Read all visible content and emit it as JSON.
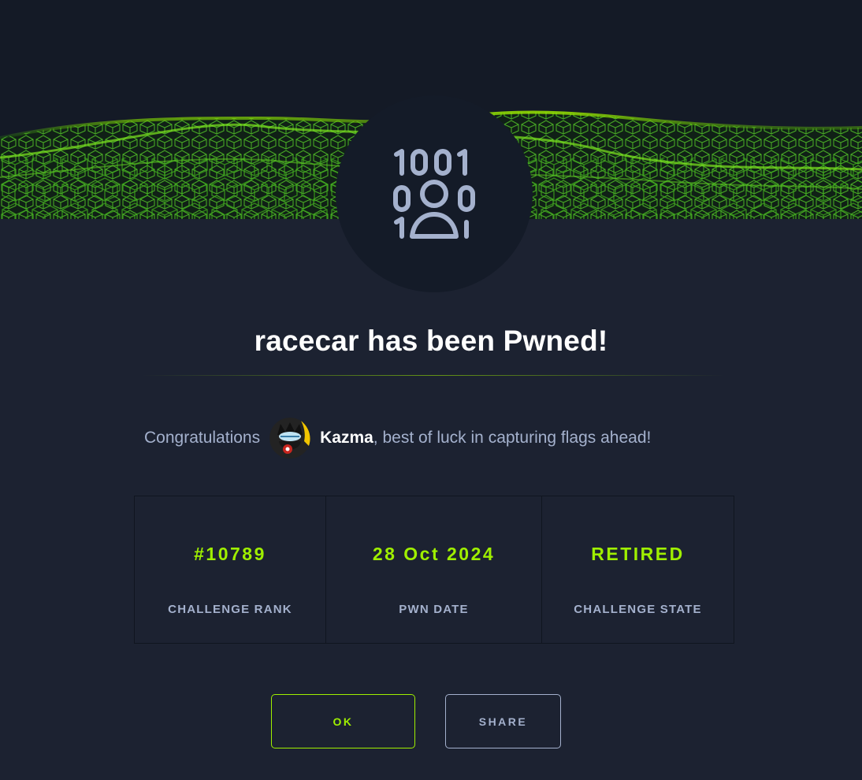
{
  "dialog": {
    "title": "racecar has been Pwned!",
    "congrats_prefix": "Congratulations",
    "username": "Kazma",
    "congrats_suffix": ", best of luck in capturing flags ahead!",
    "badge_icon": "binary-user-icon",
    "banner": "green-wave-cubes-pattern"
  },
  "stats": [
    {
      "value": "#10789",
      "label": "CHALLENGE RANK"
    },
    {
      "value": "28 Oct 2024",
      "label": "PWN DATE"
    },
    {
      "value": "RETIRED",
      "label": "CHALLENGE STATE"
    }
  ],
  "buttons": {
    "ok_label": "OK",
    "share_label": "SHARE"
  },
  "colors": {
    "accent": "#9fef00",
    "background": "#1c2231",
    "muted_text": "#a4b1cd"
  }
}
